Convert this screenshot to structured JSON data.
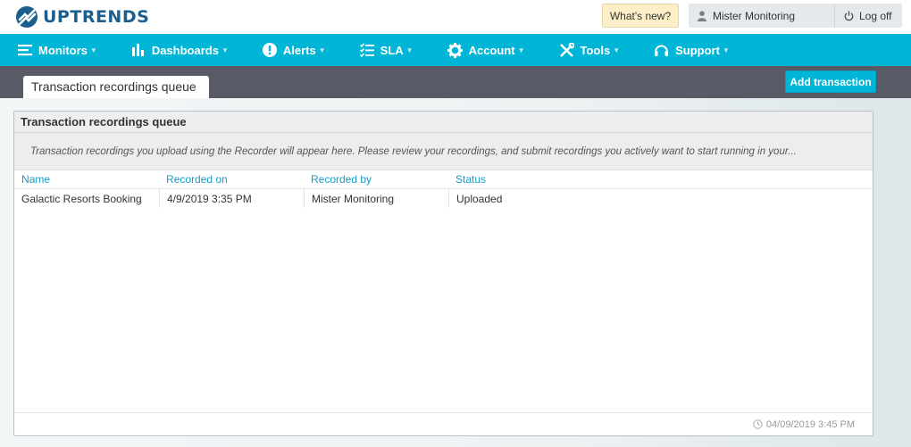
{
  "brand": {
    "name": "UPTRENDS",
    "color": "#1a5f8e"
  },
  "topbar": {
    "whats_new": "What's new?",
    "user_name": "Mister Monitoring",
    "logoff": "Log off"
  },
  "nav": {
    "accent": "#00b5d6",
    "items": [
      {
        "label": "Monitors",
        "icon": "monitors-icon"
      },
      {
        "label": "Dashboards",
        "icon": "bar-chart-icon"
      },
      {
        "label": "Alerts",
        "icon": "alert-icon"
      },
      {
        "label": "SLA",
        "icon": "checklist-icon"
      },
      {
        "label": "Account",
        "icon": "gear-icon"
      },
      {
        "label": "Tools",
        "icon": "tools-icon"
      },
      {
        "label": "Support",
        "icon": "headset-icon"
      }
    ]
  },
  "page": {
    "tab_label": "Transaction recordings queue",
    "add_button": "Add transaction"
  },
  "panel": {
    "title": "Transaction recordings queue",
    "description": "Transaction recordings you upload using the Recorder will appear here. Please review your recordings, and submit recordings you actively want to start running in your...",
    "columns": [
      "Name",
      "Recorded on",
      "Recorded by",
      "Status"
    ],
    "rows": [
      {
        "name": "Galactic Resorts Booking",
        "recorded_on": "4/9/2019 3:35 PM",
        "recorded_by": "Mister Monitoring",
        "status": "Uploaded"
      }
    ],
    "footer_timestamp": "04/09/2019 3:45 PM"
  }
}
